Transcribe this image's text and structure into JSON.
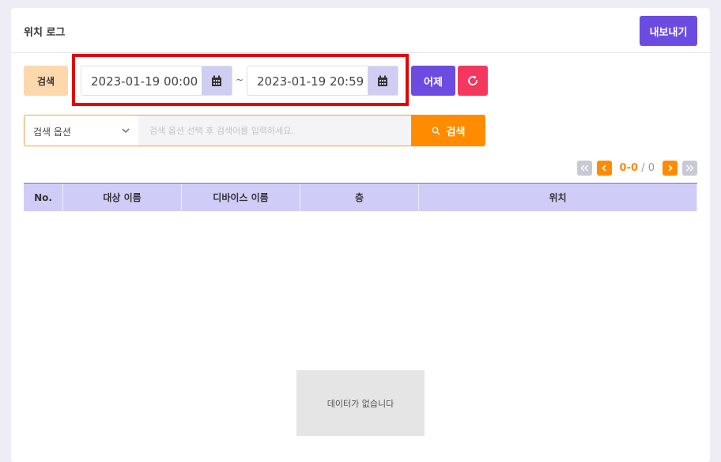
{
  "header": {
    "title": "위치 로그",
    "export_label": "내보내기"
  },
  "filter": {
    "search_tag": "검색",
    "start_date": "2023-01-19 00:00",
    "end_date": "2023-01-19 20:59",
    "separator": "~",
    "yesterday_label": "어제",
    "search_option": "검색 옵션",
    "search_placeholder": "검색 옵션 선택 후 검색어를 입력하세요.",
    "search_button_label": "검색"
  },
  "pagination": {
    "range": "0-0",
    "separator": "/",
    "total": "0"
  },
  "table": {
    "columns": [
      "No.",
      "대상 이름",
      "디바이스 이름",
      "층",
      "위치"
    ],
    "empty_message": "데이터가 없습니다"
  },
  "colors": {
    "primary": "#6c4ce0",
    "accent": "#ff8c00",
    "danger": "#f4375f",
    "highlight": "#e60000"
  },
  "icons": [
    "calendar-icon",
    "refresh-icon",
    "chevron-down-icon",
    "search-icon",
    "first-page-icon",
    "prev-page-icon",
    "next-page-icon",
    "last-page-icon"
  ]
}
